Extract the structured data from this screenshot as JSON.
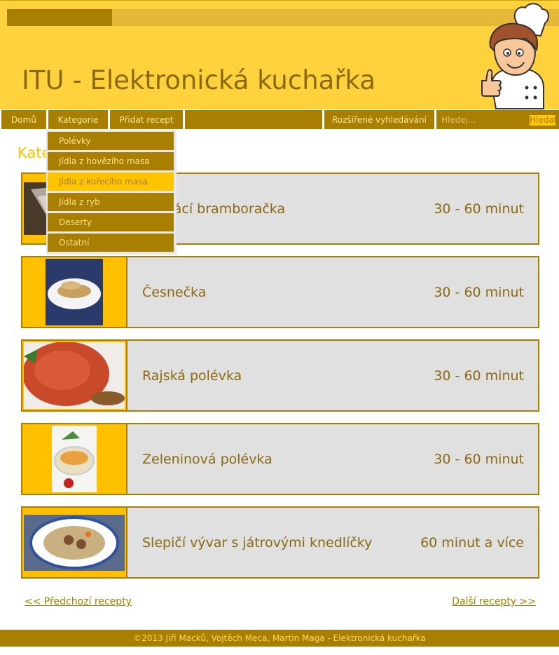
{
  "header": {
    "title": "ITU - Elektronická kuchařka"
  },
  "nav": {
    "items": [
      {
        "label": "Domů"
      },
      {
        "label": "Kategorie"
      },
      {
        "label": "Přidat recept"
      },
      {
        "label": ""
      },
      {
        "label": "Rozšířené vyhledávání"
      }
    ],
    "search": {
      "placeholder": "Hledej...",
      "button_label": "Hledat"
    }
  },
  "page": {
    "heading": "Kategorie"
  },
  "dropdown": {
    "items": [
      {
        "label": "Polévky"
      },
      {
        "label": "Jídla z hovězího masa"
      },
      {
        "label": "Jídla z kuřecího masa",
        "active": true
      },
      {
        "label": "Jídla z ryb"
      },
      {
        "label": "Deserty"
      },
      {
        "label": "Ostatní"
      }
    ]
  },
  "recipes": [
    {
      "name": "Domácí bramboračka",
      "time": "30 - 60 minut"
    },
    {
      "name": "Česnečka",
      "time": "30 - 60 minut"
    },
    {
      "name": "Rajská polévka",
      "time": "30 - 60 minut"
    },
    {
      "name": "Zeleninová polévka",
      "time": "30 - 60 minut"
    },
    {
      "name": "Slepičí vývar s játrovými knedlíčky",
      "time": "60 minut a více"
    }
  ],
  "pager": {
    "prev": "<< Předchozí recepty",
    "next": "Další recepty >>"
  },
  "footer": {
    "text": "©2013 Jiří Macků, Vojtěch Meca, Martin Maga - Elektronická kuchařka"
  },
  "colors": {
    "header_bg": "#ffd23d",
    "nav_bg": "#a87f00",
    "accent": "#ffc000",
    "row_bg": "#e0e0e0",
    "text_brown": "#8a6a10"
  }
}
